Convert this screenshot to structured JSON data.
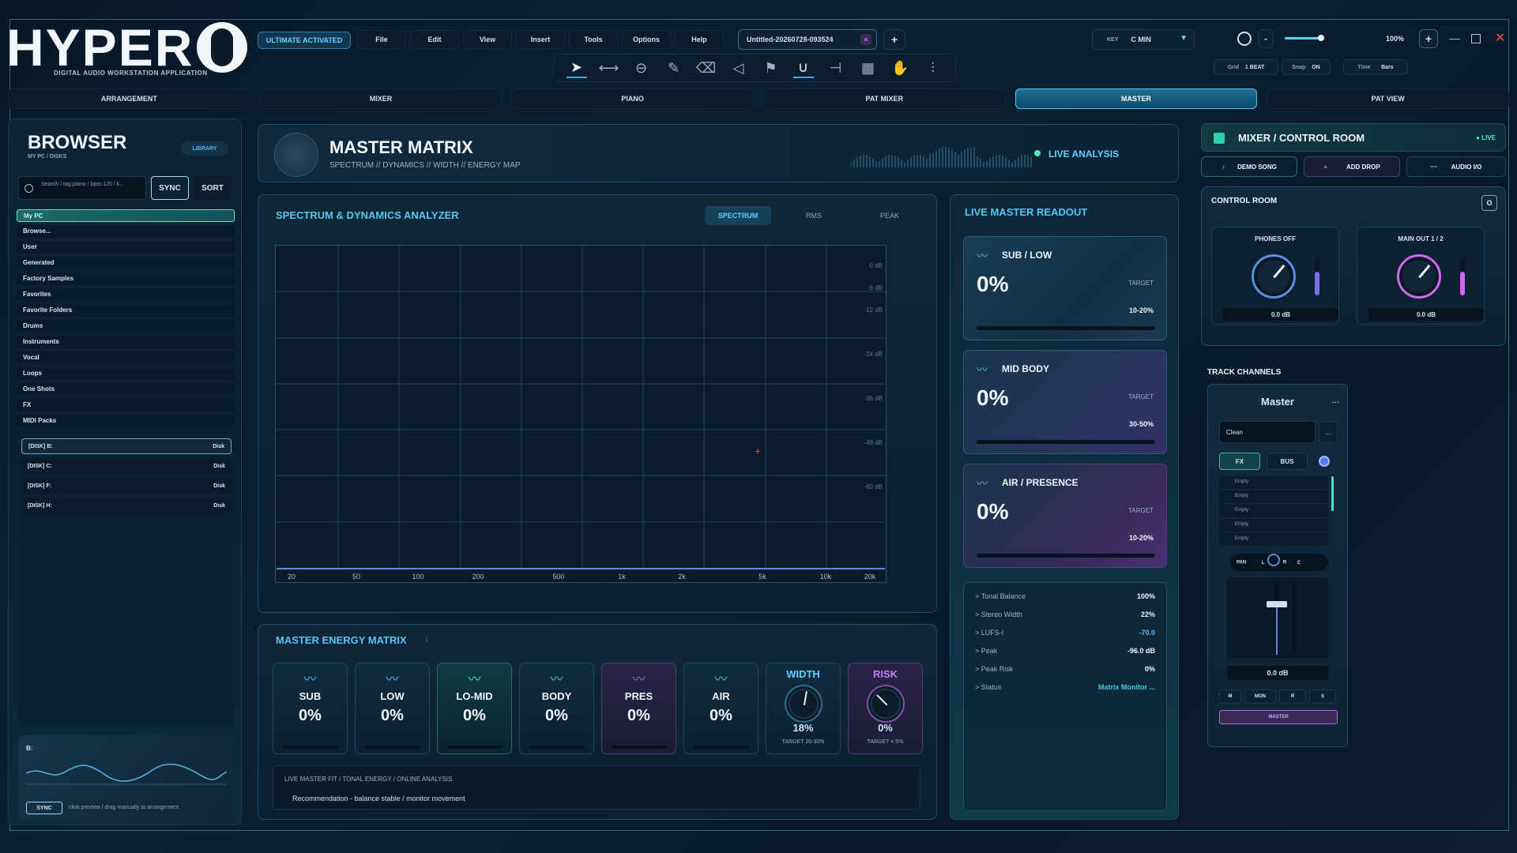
{
  "app": {
    "logo": "HYPER",
    "logo_sub": "DIGITAL AUDIO WORKSTATION APPLICATION",
    "license": "ULTIMATE ACTIVATED",
    "menus": [
      "File",
      "Edit",
      "View",
      "Insert",
      "Tools",
      "Options",
      "Help"
    ],
    "project": "Untitled-20260728-093524",
    "key_label": "KEY",
    "key_value": "C MIN",
    "zoom": "100%",
    "grid_label": "Grid",
    "grid_value": "1 BEAT",
    "snap_label": "Snap",
    "snap_value": "ON",
    "time_label": "Time",
    "time_value": "Bars"
  },
  "tools": [
    "pointer-icon",
    "range-icon",
    "link-icon",
    "pencil-icon",
    "eraser-icon",
    "mute-icon",
    "flag-icon",
    "magnet-icon",
    "split-icon",
    "grid-icon",
    "hand-icon",
    "sliders-icon"
  ],
  "tabs": [
    "ARRANGEMENT",
    "MIXER",
    "PIANO",
    "PAT MIXER",
    "MASTER",
    "PAT VIEW"
  ],
  "browser": {
    "title": "BROWSER",
    "sub": "MY PC / DISKS",
    "badge": "LIBRARY",
    "search_placeholder": "Search / tag:piano / bpm:120 / k...",
    "sync": "SYNC",
    "sort": "SORT",
    "items": [
      "My PC",
      "Browse...",
      "User",
      "Generated",
      "Factory Samples",
      "Favorites",
      "Favorite Folders",
      "Drums",
      "Instruments",
      "Vocal",
      "Loops",
      "One Shots",
      "FX",
      "MIDI Packs"
    ],
    "disks": [
      {
        "name": "[DISK] B:",
        "type": "Disk"
      },
      {
        "name": "[DISK] C:",
        "type": "Disk"
      },
      {
        "name": "[DISK] F:",
        "type": "Disk"
      },
      {
        "name": "[DISK] H:",
        "type": "Disk"
      }
    ],
    "preview_label": "B:",
    "preview_sync": "SYNC",
    "preview_hint": "click preview / drag manually to arrangement"
  },
  "master": {
    "title": "MASTER MATRIX",
    "subtitle": "SPECTRUM // DYNAMICS // WIDTH // ENERGY MAP",
    "live": "LIVE ANALYSIS"
  },
  "analyzer": {
    "title": "SPECTRUM & DYNAMICS ANALYZER",
    "tabs": [
      "SPECTRUM",
      "RMS",
      "PEAK"
    ],
    "db_labels": [
      "0 dB",
      "-6 dB",
      "-12 dB",
      "-24 dB",
      "-36 dB",
      "-48 dB",
      "-60 dB"
    ],
    "freq_labels": [
      "20",
      "50",
      "100",
      "200",
      "500",
      "1k",
      "2k",
      "5k",
      "10k",
      "20k"
    ]
  },
  "energy": {
    "title": "MASTER ENERGY MATRIX",
    "info": "i",
    "bands": [
      {
        "label": "SUB",
        "value": "0%",
        "style": "blue"
      },
      {
        "label": "LOW",
        "value": "0%",
        "style": "blue"
      },
      {
        "label": "LO-MID",
        "value": "0%",
        "style": "teal"
      },
      {
        "label": "BODY",
        "value": "0%",
        "style": "blue"
      },
      {
        "label": "PRES",
        "value": "0%",
        "style": "purple"
      },
      {
        "label": "AIR",
        "value": "0%",
        "style": "blue"
      }
    ],
    "width": {
      "label": "WIDTH",
      "value": "18%",
      "target": "TARGET 20-30%"
    },
    "risk": {
      "label": "RISK",
      "value": "0%",
      "target": "TARGET < 5%"
    },
    "note_line1": "LIVE MASTER FIT  /  TONAL ENERGY  /  ONLINE ANALYSIS",
    "note_line2": "Recommendation  -  balance stable / monitor movement"
  },
  "readout": {
    "title": "LIVE MASTER READOUT",
    "cards": [
      {
        "name": "SUB / LOW",
        "value": "0%",
        "target_label": "TARGET",
        "target": "10-20%"
      },
      {
        "name": "MID BODY",
        "value": "0%",
        "target_label": "TARGET",
        "target": "30-50%"
      },
      {
        "name": "AIR / PRESENCE",
        "value": "0%",
        "target_label": "TARGET",
        "target": "10-20%"
      }
    ],
    "stats": [
      {
        "k": "> Tonal Balance",
        "v": "100%"
      },
      {
        "k": "> Stereo Width",
        "v": "22%"
      },
      {
        "k": "> LUFS-I",
        "v": "-70.0"
      },
      {
        "k": "> Peak",
        "v": "-96.0 dB"
      },
      {
        "k": "> Peak Risk",
        "v": "0%"
      },
      {
        "k": "> Status",
        "v": "Matrix Monitor ..."
      }
    ]
  },
  "control": {
    "title": "MIXER / CONTROL ROOM",
    "live": "LIVE",
    "buttons": [
      "DEMO SONG",
      "ADD DROP",
      "AUDIO I/O"
    ],
    "cr_title": "CONTROL ROOM",
    "cr_btn": "O",
    "phones": {
      "label": "PHONES OFF",
      "db": "0.0 dB"
    },
    "main": {
      "label": "MAIN OUT 1 / 2",
      "db": "0.0 dB"
    },
    "tracks_title": "TRACK CHANNELS",
    "strip": {
      "name": "Master",
      "menu": "...",
      "preset": "Clean",
      "preset_btn": "...",
      "fx": "FX",
      "bus": "BUS",
      "slots": [
        "Empty",
        "Empty",
        "Empty",
        "Empty",
        "Empty"
      ],
      "pan": "PAN",
      "pan_l": "L",
      "pan_r": "R",
      "pan_c": "C",
      "db": "0.0 dB",
      "m": "M",
      "mon": "MON",
      "r": "R",
      "s": "S",
      "out": "MASTER"
    }
  }
}
